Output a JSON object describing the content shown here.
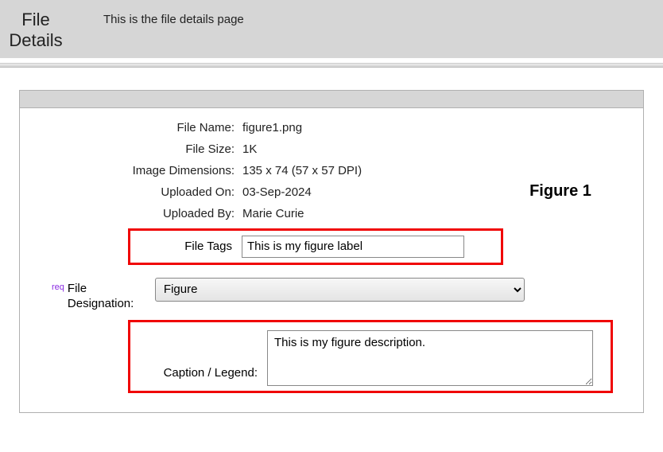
{
  "header": {
    "title": "File Details",
    "subtitle": "This is the file details page"
  },
  "file": {
    "name_label": "File Name:",
    "name_value": "figure1.png",
    "size_label": "File Size:",
    "size_value": "1K",
    "dim_label": "Image Dimensions:",
    "dim_value": "135 x 74 (57 x 57 DPI)",
    "uploaded_on_label": "Uploaded On:",
    "uploaded_on_value": "03-Sep-2024",
    "uploaded_by_label": "Uploaded By:",
    "uploaded_by_value": "Marie Curie"
  },
  "thumb_text": "Figure 1",
  "tags": {
    "label": "File Tags",
    "value": "This is my figure label"
  },
  "designation": {
    "req": "req",
    "label": "File Designation:",
    "selected": "Figure"
  },
  "caption": {
    "label": "Caption / Legend:",
    "value": "This is my figure description."
  }
}
